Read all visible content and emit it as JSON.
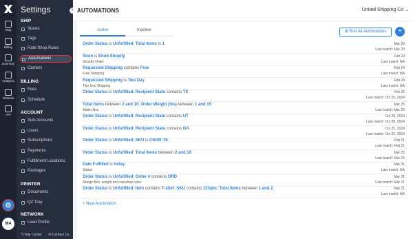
{
  "rail": {
    "items": [
      {
        "label": "Ship"
      },
      {
        "label": "Billing"
      },
      {
        "label": "Inventory"
      },
      {
        "label": "Analytics"
      },
      {
        "label": "Network"
      },
      {
        "label": "API"
      }
    ],
    "avatar_initials": "MA"
  },
  "nav": {
    "title": "Settings",
    "collapse": "‹",
    "sections": {
      "ship": "SHIP",
      "billing": "BILLING",
      "account": "ACCOUNT",
      "printer": "PRINTER",
      "network": "NETWORK"
    },
    "ship_items": [
      "Stores",
      "Tags",
      "Rate Shop Rules",
      "Automations",
      "Carriers"
    ],
    "billing_items": [
      "Fees",
      "Schedule"
    ],
    "account_items": [
      "Sub-Accounts",
      "Users",
      "Subscriptions",
      "Payments",
      "Fulfillment Locations",
      "Packages"
    ],
    "printer_items": [
      "Documents",
      "QZ Tray"
    ],
    "network_items": [
      "Lead Profile"
    ],
    "footer": {
      "help": "Help Center",
      "contact": "Contact Us"
    }
  },
  "header": {
    "title": "AUTOMATIONS",
    "company": "United Shipping Co"
  },
  "main": {
    "tabs": [
      "Active",
      "Inactive"
    ],
    "run_all_label": "Run All Automations",
    "add_label": "+",
    "new_label": "+ New Automation",
    "rows": [
      {
        "c1": "Order Status",
        "o1": " is ",
        "v1": "Unfulfilled",
        "sep": "; ",
        "c2": "Total Items",
        "o2": " is ",
        "v2": "1",
        "sub": "",
        "date": "Mar 20",
        "last": "Last match: Mar 20"
      },
      {
        "c1": "Store",
        "o1": " is ",
        "v1": "Ehub Shopify",
        "sep": "",
        "c2": "",
        "o2": "",
        "v2": "",
        "sub": "Shopify Order",
        "date": "Feb 24",
        "last": "Last match: NA"
      },
      {
        "c1": "Requested Shipping",
        "o1": " contains ",
        "v1": "Free",
        "sep": "",
        "c2": "",
        "o2": "",
        "v2": "",
        "sub": "Free Shipping",
        "date": "Feb 24",
        "last": "Last match: NA"
      },
      {
        "c1": "Requested Shipping",
        "o1": " is ",
        "v1": "Two Day",
        "sep": "",
        "c2": "",
        "o2": "",
        "v2": "",
        "sub": "Two Day Shipping",
        "date": "Feb 24",
        "last": "Last match: NA"
      },
      {
        "c1": "Order Status",
        "o1": " is ",
        "v1": "Unfulfilled",
        "sep": "; ",
        "c2": "Recipient State",
        "o2": " contains ",
        "v2": "TX",
        "sub": "",
        "date": "Feb 26",
        "last": "Last match: Oct 25, 2024"
      },
      {
        "c1": "Total Items",
        "o1": " between ",
        "v1": "2 and 10",
        "sep": "; ",
        "c2": "Order Weight (lbs)",
        "o2": " between ",
        "v2": "1 and 15",
        "sub": "Mailer Box",
        "date": "Mar 25",
        "last": "Last match: Mar 25"
      },
      {
        "c1": "Order Status",
        "o1": " is ",
        "v1": "Unfulfilled",
        "sep": "; ",
        "c2": "Recipient State",
        "o2": " contains ",
        "v2": "UT",
        "sub": "",
        "date": "Oct 29, 2024",
        "last": "Last match: Oct 28, 2024"
      },
      {
        "c1": "Order Status",
        "o1": " is ",
        "v1": "Unfulfilled",
        "sep": "; ",
        "c2": "Recipient State",
        "o2": " contains ",
        "v2": "GA",
        "sub": "",
        "date": "Oct 25, 2024",
        "last": "Last match: Oct 25, 2024"
      },
      {
        "c1": "Order Status",
        "o1": " is ",
        "v1": "Unfulfilled",
        "sep": "; ",
        "c2": "SKU",
        "o2": " is ",
        "v2": "CHAR-TS",
        "sub": "",
        "date": "Feb 21",
        "last": "Last match: Feb 21"
      },
      {
        "c1": "Order Status",
        "o1": " is ",
        "v1": "Unfulfilled",
        "sep": "; ",
        "c2": "Total Items",
        "o2": " between ",
        "v2": "2 and 10",
        "sub": "",
        "date": "Mar 25",
        "last": "Last match: Mar 25"
      },
      {
        "c1": "Date Fulfilled",
        "o1": " is ",
        "v1": "today",
        "sep": "",
        "c2": "",
        "o2": "",
        "v2": "",
        "sub": "Status",
        "date": "Mar 21",
        "last": "Last match: NA"
      },
      {
        "c1": "Order Status",
        "o1": " is ",
        "v1": "Unfulfilled",
        "sep": "; ",
        "c2": "Order #",
        "o2": " contains ",
        "v2": "ORD",
        "sub": "Assign Box, weight and rateshop rules",
        "date": "Mar 21",
        "last": "Last match: Mar 21"
      },
      {
        "c1": "Order Status",
        "o1": " is ",
        "v1": "Unfulfilled",
        "sep": "; ",
        "c2": "Item",
        "o2": " contains ",
        "v2": "T-shirt",
        "sep2": "; ",
        "c3": "SKU",
        "o3": " contains ",
        "v3": "123abc",
        "sep3": "; ",
        "c4": "Total Items",
        "o4": " between ",
        "v4": "1 and 2",
        "sub": "",
        "date": "Mar 21",
        "last": "Last match: NA"
      }
    ]
  },
  "colors": {
    "accent": "#2f7fd8",
    "sidebar_dark": "#1d2331",
    "nav_bg": "#262d3d",
    "highlight": "#e1322f"
  }
}
